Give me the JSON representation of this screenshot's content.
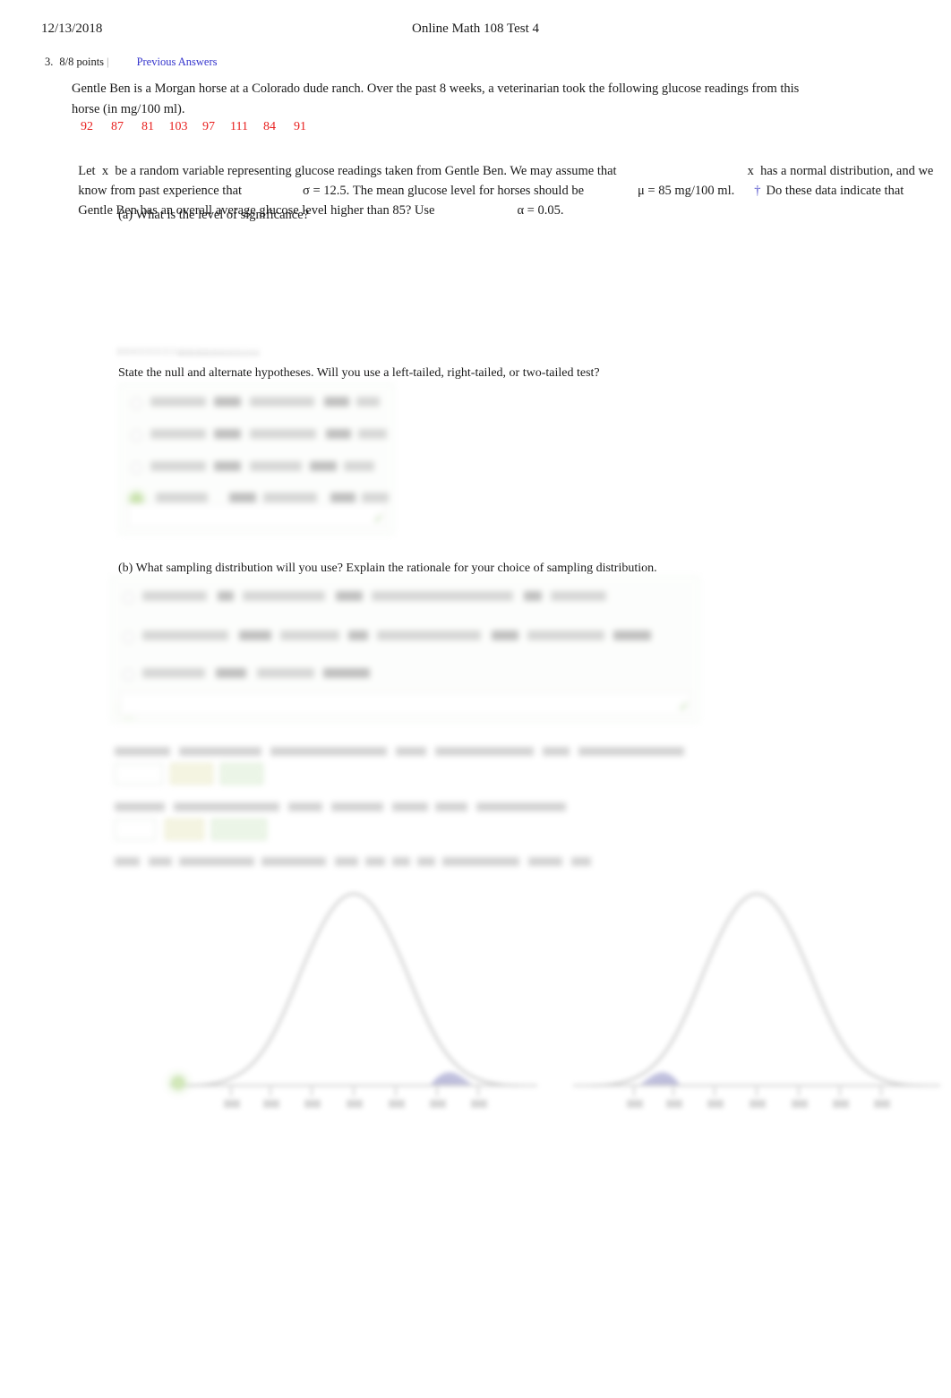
{
  "header": {
    "date": "12/13/2018",
    "title": "Online Math 108 Test 4"
  },
  "problem": {
    "number": "3.",
    "points": "8/8 points",
    "separator": "|",
    "previous_answers_link": "Previous Answers"
  },
  "question": {
    "paragraph_line1": "Gentle Ben is a Morgan horse at a Colorado dude ranch. Over the past 8 weeks, a veterinarian took the following glucose readings from this",
    "paragraph_line2": "horse (in mg/100 ml).",
    "data_values": [
      "92",
      "87",
      "81",
      "103",
      "97",
      "111",
      "84",
      "91"
    ],
    "data_color": "#e8201f",
    "stat_line1_a": "Let  x  be a random variable representing glucose readings taken from Gentle Ben. We may assume that",
    "stat_line1_b": "x  has a normal distribution, and we",
    "stat_line2_a": "know from past experience that",
    "stat_line2_b": "σ = 12.5. The mean glucose level for horses should be",
    "stat_line2_c": "μ = 85 mg/100 ml.",
    "stat_line2_dagger": "†",
    "stat_line2_d": "Do these data indicate that",
    "stat_line3_a": "Gentle Ben has an overall average glucose level higher than 85? Use",
    "stat_line3_b": "α = 0.05.",
    "part_a_label": "(a) What is the level of significance?",
    "prompt_hypotheses": "State the null and alternate hypotheses. Will you use a left-tailed, right-tailed, or two-tailed test?",
    "prompt_part_b": "(b) What sampling distribution will you use? Explain the rationale for your choice of sampling distribution."
  },
  "hypotheses_choices": {
    "obscured": true,
    "option_count": 4,
    "selected_index": 3,
    "selected_marker": "✓",
    "marker_color": "#5aa02c"
  },
  "sampling_choices": {
    "obscured": true,
    "option_count": 4,
    "selected_index": 3,
    "selected_marker": "✓",
    "marker_color": "#5aa02c"
  },
  "obscured_answers": [
    {
      "name": "compute-sample-test-statistic",
      "lines": 1,
      "inputs": 2
    },
    {
      "name": "find-p-value",
      "lines": 1,
      "inputs": 2
    },
    {
      "name": "sketch-sampling-distribution",
      "lines": 1,
      "inputs": 0
    }
  ],
  "sketch": {
    "obscured": true,
    "graph_count": 2,
    "graphs": [
      {
        "name": "normal-curve-right-tail-shaded",
        "shaded_tail": "right",
        "selected": true
      },
      {
        "name": "normal-curve-left-tail-shaded",
        "shaded_tail": "left",
        "selected": false
      }
    ],
    "shade_color": "#6a6ab0",
    "curve_color": "#8a8a8a",
    "tick_count": 7
  }
}
